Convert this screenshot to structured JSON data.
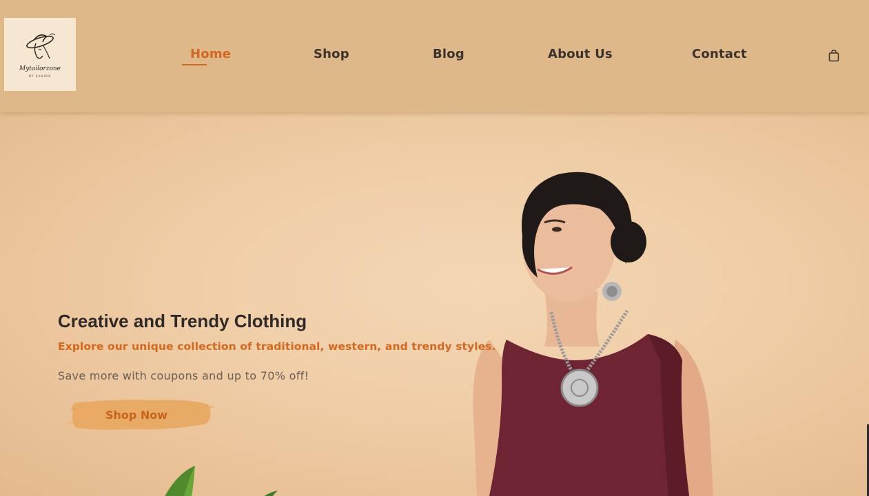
{
  "logo": {
    "name": "Mytailorzone",
    "tagline": "BY SAHIBA"
  },
  "nav": {
    "items": [
      {
        "label": "Home",
        "active": true
      },
      {
        "label": "Shop",
        "active": false
      },
      {
        "label": "Blog",
        "active": false
      },
      {
        "label": "About Us",
        "active": false
      },
      {
        "label": "Contact",
        "active": false
      }
    ],
    "cart_icon": "shopping-bag-icon"
  },
  "hero": {
    "title": "Creative and Trendy Clothing",
    "subtitle": "Explore our unique collection of traditional, western, and trendy styles.",
    "description": "Save more with coupons and up to 70% off!",
    "cta_label": "Shop Now"
  },
  "colors": {
    "header_bg": "#dfb889",
    "accent": "#d2691e",
    "hero_bg": "#efcda6",
    "button_brush": "#e9a85f",
    "text_dark": "#2f2a28"
  }
}
